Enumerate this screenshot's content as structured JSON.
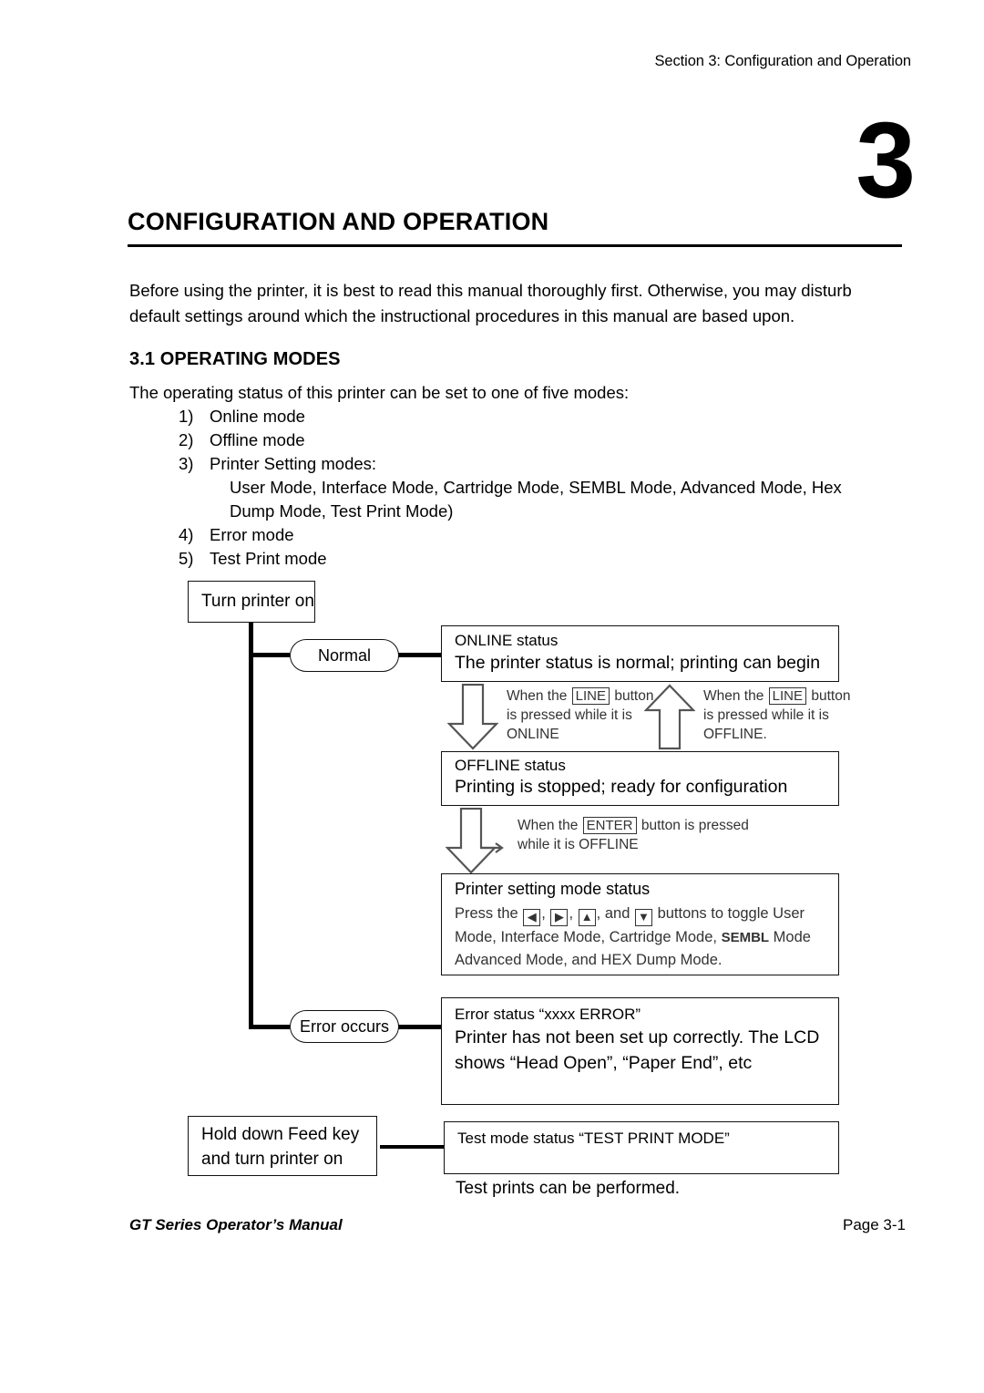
{
  "header": {
    "running_head": "Section 3: Configuration and Operation",
    "chapter_numeral": "3",
    "chapter_title": "CONFIGURATION AND OPERATION"
  },
  "intro": {
    "paragraph": "Before using the printer, it is best to read this manual thoroughly first. Otherwise, you may disturb default settings around which the instructional procedures in this manual are based upon."
  },
  "section": {
    "heading": "3.1 OPERATING MODES",
    "lead_in": "The operating status of this printer can be set to one of five modes:",
    "items": [
      {
        "num": "1)",
        "text": "Online mode"
      },
      {
        "num": "2)",
        "text": "Offline mode"
      },
      {
        "num": "3)",
        "text": "Printer Setting modes:"
      },
      {
        "num": "4)",
        "text": "Error mode"
      },
      {
        "num": "5)",
        "text": "Test Print mode"
      }
    ],
    "item3_sub_line1": "User Mode, Interface Mode, Cartridge Mode, SEMBL Mode, Advanced Mode, Hex",
    "item3_sub_line2": "Dump Mode, Test Print Mode)"
  },
  "diagram": {
    "start_box": {
      "line1": "Turn printer on"
    },
    "testprint_box": {
      "line1": "Hold down Feed key",
      "line2": "and turn printer on"
    },
    "branch_normal": "Normal",
    "branch_error": "Error occurs",
    "online_box": {
      "title": "ONLINE status",
      "body": "The printer status is normal; printing can begin"
    },
    "offline_box": {
      "title": "OFFLINE status",
      "body": "Printing is stopped; ready for configuration"
    },
    "setting_box": {
      "title": "Printer setting mode status",
      "line_a_pre": "Press the",
      "key_left": "◀",
      "key_right": "▶",
      "key_up": "▲",
      "key_down": "▼",
      "line_a_mid": ", and",
      "line_a_post": "buttons to toggle User",
      "line_b_pre": "Mode, Interface Mode, Cartridge Mode,",
      "line_b_bold": "SEMBL",
      "line_b_post": "Mode",
      "line_c": "Advanced Mode, and HEX Dump Mode."
    },
    "error_box": {
      "title": "Error status “xxxx ERROR”",
      "body_line1": "Printer has not been set up correctly. The LCD",
      "body_line2": "shows “Head Open”, “Paper End”, etc"
    },
    "testmode_box": {
      "title": "Test mode status “TEST PRINT MODE”"
    },
    "testprint_caption": "Test prints can be performed.",
    "arrow_down_line": {
      "l1_pre": "When the",
      "l1_key": "LINE",
      "l1_post": "button",
      "l2": "is pressed while it is",
      "l3": "ONLINE"
    },
    "arrow_up_line": {
      "l1_pre": "When the",
      "l1_key": "LINE",
      "l1_post": "button",
      "l2": "is pressed while it is",
      "l3": "OFFLINE."
    },
    "arrow_enter": {
      "l1_pre": "When the",
      "l1_key": "ENTER",
      "l1_post": "button is pressed",
      "l2": "while it is OFFLINE"
    }
  },
  "footer": {
    "left": "GT Series Operator’s Manual",
    "right": "Page 3-1"
  }
}
